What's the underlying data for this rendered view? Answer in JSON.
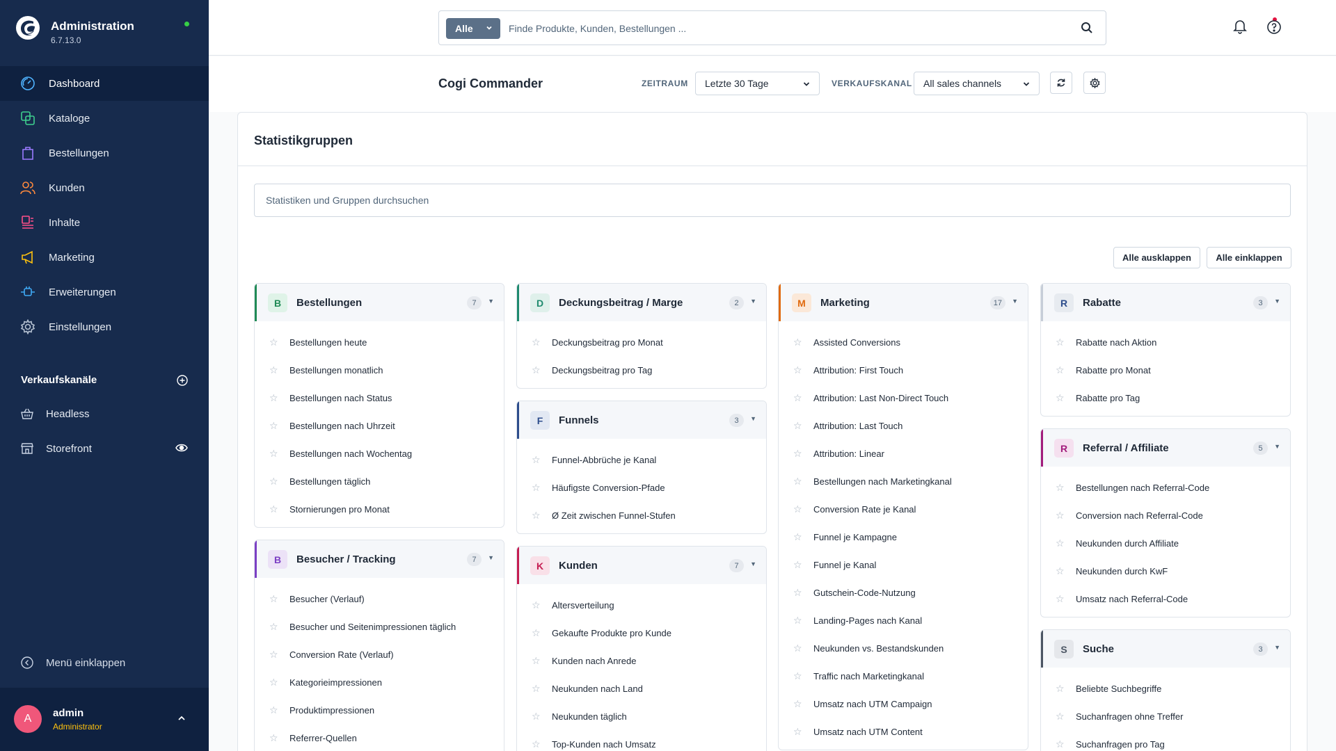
{
  "app": {
    "title": "Administration",
    "version": "6.7.13.0"
  },
  "sidebar": {
    "items": [
      {
        "label": "Dashboard",
        "icon": "dashboard-icon",
        "active": true
      },
      {
        "label": "Kataloge",
        "icon": "catalog-icon"
      },
      {
        "label": "Bestellungen",
        "icon": "shopping-bag-icon"
      },
      {
        "label": "Kunden",
        "icon": "customers-icon"
      },
      {
        "label": "Inhalte",
        "icon": "content-icon"
      },
      {
        "label": "Marketing",
        "icon": "megaphone-icon"
      },
      {
        "label": "Erweiterungen",
        "icon": "plug-icon"
      },
      {
        "label": "Einstellungen",
        "icon": "gear-icon"
      }
    ],
    "channels_title": "Verkaufskanäle",
    "channels": [
      {
        "label": "Headless",
        "icon": "basket-icon"
      },
      {
        "label": "Storefront",
        "icon": "storefront-icon"
      }
    ],
    "collapse_label": "Menü einklappen",
    "user": {
      "initial": "A",
      "name": "admin",
      "role": "Administrator"
    }
  },
  "topbar": {
    "search_scope": "Alle",
    "search_placeholder": "Finde Produkte, Kunden, Bestellungen ..."
  },
  "header": {
    "title": "Cogi Commander",
    "period_label": "ZEITRAUM",
    "period_value": "Letzte 30 Tage",
    "channel_label": "VERKAUFSKANAL",
    "channel_value": "All sales channels"
  },
  "main": {
    "title": "Statistikgruppen",
    "search_placeholder": "Statistiken und Gruppen durchsuchen",
    "expand_all": "Alle ausklappen",
    "collapse_all": "Alle einklappen",
    "columns": [
      [
        {
          "letter": "B",
          "title": "Bestellungen",
          "count": "7",
          "color": "#1f8a55",
          "letter_bg": "#dff3e8",
          "items": [
            "Bestellungen heute",
            "Bestellungen monatlich",
            "Bestellungen nach Status",
            "Bestellungen nach Uhrzeit",
            "Bestellungen nach Wochentag",
            "Bestellungen täglich",
            "Stornierungen pro Monat"
          ]
        },
        {
          "letter": "B",
          "title": "Besucher / Tracking",
          "count": "7",
          "color": "#7b3fc4",
          "letter_bg": "#ece2f7",
          "items": [
            "Besucher (Verlauf)",
            "Besucher und Seitenimpressionen täglich",
            "Conversion Rate (Verlauf)",
            "Kategorieimpressionen",
            "Produktimpressionen",
            "Referrer-Quellen"
          ]
        }
      ],
      [
        {
          "letter": "D",
          "title": "Deckungsbeitrag / Marge",
          "count": "2",
          "color": "#1f8a6e",
          "letter_bg": "#dff0eb",
          "items": [
            "Deckungsbeitrag pro Monat",
            "Deckungsbeitrag pro Tag"
          ]
        },
        {
          "letter": "F",
          "title": "Funnels",
          "count": "3",
          "color": "#2d4d8c",
          "letter_bg": "#e2e8f3",
          "items": [
            "Funnel-Abbrüche je Kanal",
            "Häufigste Conversion-Pfade",
            "Ø Zeit zwischen Funnel-Stufen"
          ]
        },
        {
          "letter": "K",
          "title": "Kunden",
          "count": "7",
          "color": "#c51d52",
          "letter_bg": "#f9e0e8",
          "items": [
            "Altersverteilung",
            "Gekaufte Produkte pro Kunde",
            "Kunden nach Anrede",
            "Neukunden nach Land",
            "Neukunden täglich",
            "Top-Kunden nach Umsatz"
          ]
        }
      ],
      [
        {
          "letter": "M",
          "title": "Marketing",
          "count": "17",
          "color": "#e06a0f",
          "letter_bg": "#fbe8d8",
          "items": [
            "Assisted Conversions",
            "Attribution: First Touch",
            "Attribution: Last Non-Direct Touch",
            "Attribution: Last Touch",
            "Attribution: Linear",
            "Bestellungen nach Marketingkanal",
            "Conversion Rate je Kanal",
            "Funnel je Kampagne",
            "Funnel je Kanal",
            "Gutschein-Code-Nutzung",
            "Landing-Pages nach Kanal",
            "Neukunden vs. Bestandskunden",
            "Traffic nach Marketingkanal",
            "Umsatz nach UTM Campaign",
            "Umsatz nach UTM Content"
          ]
        }
      ],
      [
        {
          "letter": "R",
          "title": "Rabatte",
          "count": "3",
          "color": "#c7ced8",
          "letter_bg": "#e7ebf0",
          "items": [
            "Rabatte nach Aktion",
            "Rabatte pro Monat",
            "Rabatte pro Tag"
          ]
        },
        {
          "letter": "R",
          "title": "Referral / Affiliate",
          "count": "5",
          "color": "#a21c7c",
          "letter_bg": "#f5e0ef",
          "items": [
            "Bestellungen nach Referral-Code",
            "Conversion nach Referral-Code",
            "Neukunden durch Affiliate",
            "Neukunden durch KwF",
            "Umsatz nach Referral-Code"
          ]
        },
        {
          "letter": "S",
          "title": "Suche",
          "count": "3",
          "color": "#4b5563",
          "letter_bg": "#e5e7eb",
          "items": [
            "Beliebte Suchbegriffe",
            "Suchanfragen ohne Treffer",
            "Suchanfragen pro Tag"
          ]
        }
      ]
    ]
  }
}
